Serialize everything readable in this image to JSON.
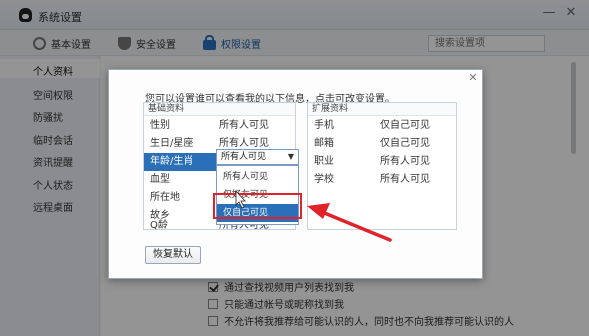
{
  "window": {
    "title": "系统设置"
  },
  "tabs": [
    {
      "label": "基本设置",
      "icon": "gear-icon"
    },
    {
      "label": "安全设置",
      "icon": "shield-icon"
    },
    {
      "label": "权限设置",
      "icon": "lock-icon",
      "active": true
    }
  ],
  "search": {
    "placeholder": "搜索设置项"
  },
  "sidebar": {
    "items": [
      {
        "label": "个人资料",
        "active": true
      },
      {
        "label": "空间权限"
      },
      {
        "label": "防骚扰"
      },
      {
        "label": "临时会话"
      },
      {
        "label": "资讯提醒"
      },
      {
        "label": "个人状态"
      },
      {
        "label": "远程桌面"
      }
    ]
  },
  "background_options": [
    {
      "label": "通过查找视频用户列表找到我",
      "checked": true
    },
    {
      "label": "只能通过帐号或昵称找到我",
      "checked": false
    },
    {
      "label": "不允许将我推荐给可能认识的人，同时也不向我推荐可能认识的人",
      "checked": false
    }
  ],
  "dialog": {
    "hint": "您可以设置谁可以查看我的以下信息，点击可改变设置。",
    "left_panel": {
      "header": "基础资料",
      "rows": [
        {
          "key": "性别",
          "value": "所有人可见"
        },
        {
          "key": "生日/星座",
          "value": "所有人可见"
        },
        {
          "key": "年龄/生肖",
          "value": "所有人可见",
          "selected": true
        },
        {
          "key": "血型",
          "value": ""
        },
        {
          "key": "所在地",
          "value": ""
        },
        {
          "key": "故乡",
          "value": ""
        },
        {
          "key": "Q龄",
          "value": "所有人可见"
        }
      ]
    },
    "right_panel": {
      "header": "扩展资料",
      "rows": [
        {
          "key": "手机",
          "value": "仅自己可见"
        },
        {
          "key": "邮箱",
          "value": "仅自己可见"
        },
        {
          "key": "职业",
          "value": "所有人可见"
        },
        {
          "key": "学校",
          "value": "所有人可见"
        }
      ]
    },
    "combo_value": "所有人可见",
    "dropdown_options": [
      "所有人可见",
      "仅好友可见",
      "仅自己可见"
    ],
    "highlighted_option": "仅自己可见",
    "restore_button": "恢复默认"
  },
  "colors": {
    "accent": "#2a6fb8",
    "annotation_red": "#e0222b"
  }
}
